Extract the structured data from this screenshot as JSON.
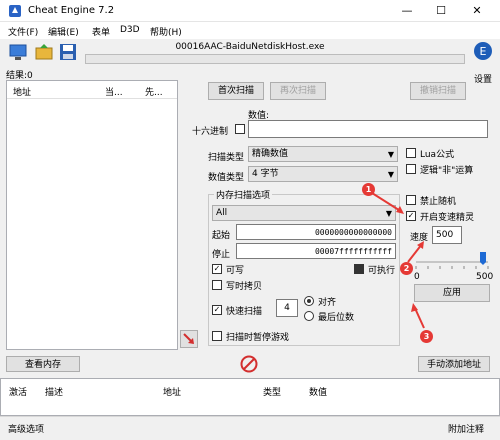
{
  "window": {
    "title": "Cheat Engine 7.2",
    "minimize": "—",
    "maximize": "☐",
    "close": "✕"
  },
  "menu": [
    "文件(F)",
    "编辑(E)",
    "表单",
    "D3D",
    "帮助(H)"
  ],
  "process_title": "00016AAC-BaiduNetdiskHost.exe",
  "results_label": "结果:0",
  "settings_label": "设置",
  "results_columns": [
    "地址",
    "当...",
    "先..."
  ],
  "scan": {
    "first_scan": "首次扫描",
    "next_scan": "再次扫描",
    "undo_scan": "撤销扫描",
    "value_label": "数值:",
    "hex_label": "十六进制",
    "hex_checked": false,
    "value_input": "",
    "scan_type_label": "扫描类型",
    "scan_type_value": "精确数值",
    "value_type_label": "数值类型",
    "value_type_value": "4 字节",
    "lua_formula": "Lua公式",
    "logic_not": "逻辑\"非\"运算",
    "mem_options_title": "内存扫描选项",
    "region_value": "All",
    "start_label": "起始",
    "start_value": "0000000000000000",
    "stop_label": "停止",
    "stop_value": "00007fffffffffff",
    "writable": "可写",
    "executable": "可执行",
    "copy_on_write": "写时拷贝",
    "fast_scan": "快速扫描",
    "fast_scan_value": "4",
    "align": "对齐",
    "last_digits": "最后位数",
    "pause_game": "扫描时暂停游戏",
    "disable_random": "禁止随机",
    "enable_speedhack": "开启变速精灵",
    "speed_label": "速度",
    "speed_value": "500",
    "slider_min": "0",
    "slider_max": "500",
    "apply": "应用"
  },
  "bottom": {
    "view_memory": "查看内存",
    "add_address": "手动添加地址",
    "table_columns": [
      "激活",
      "描述",
      "地址",
      "类型",
      "数值"
    ],
    "advanced": "高级选项",
    "attach_notes": "附加注释"
  },
  "annotations": [
    "1",
    "2",
    "3"
  ],
  "colors": {
    "accent": "#e53935",
    "slider": "#1e6ad4"
  }
}
